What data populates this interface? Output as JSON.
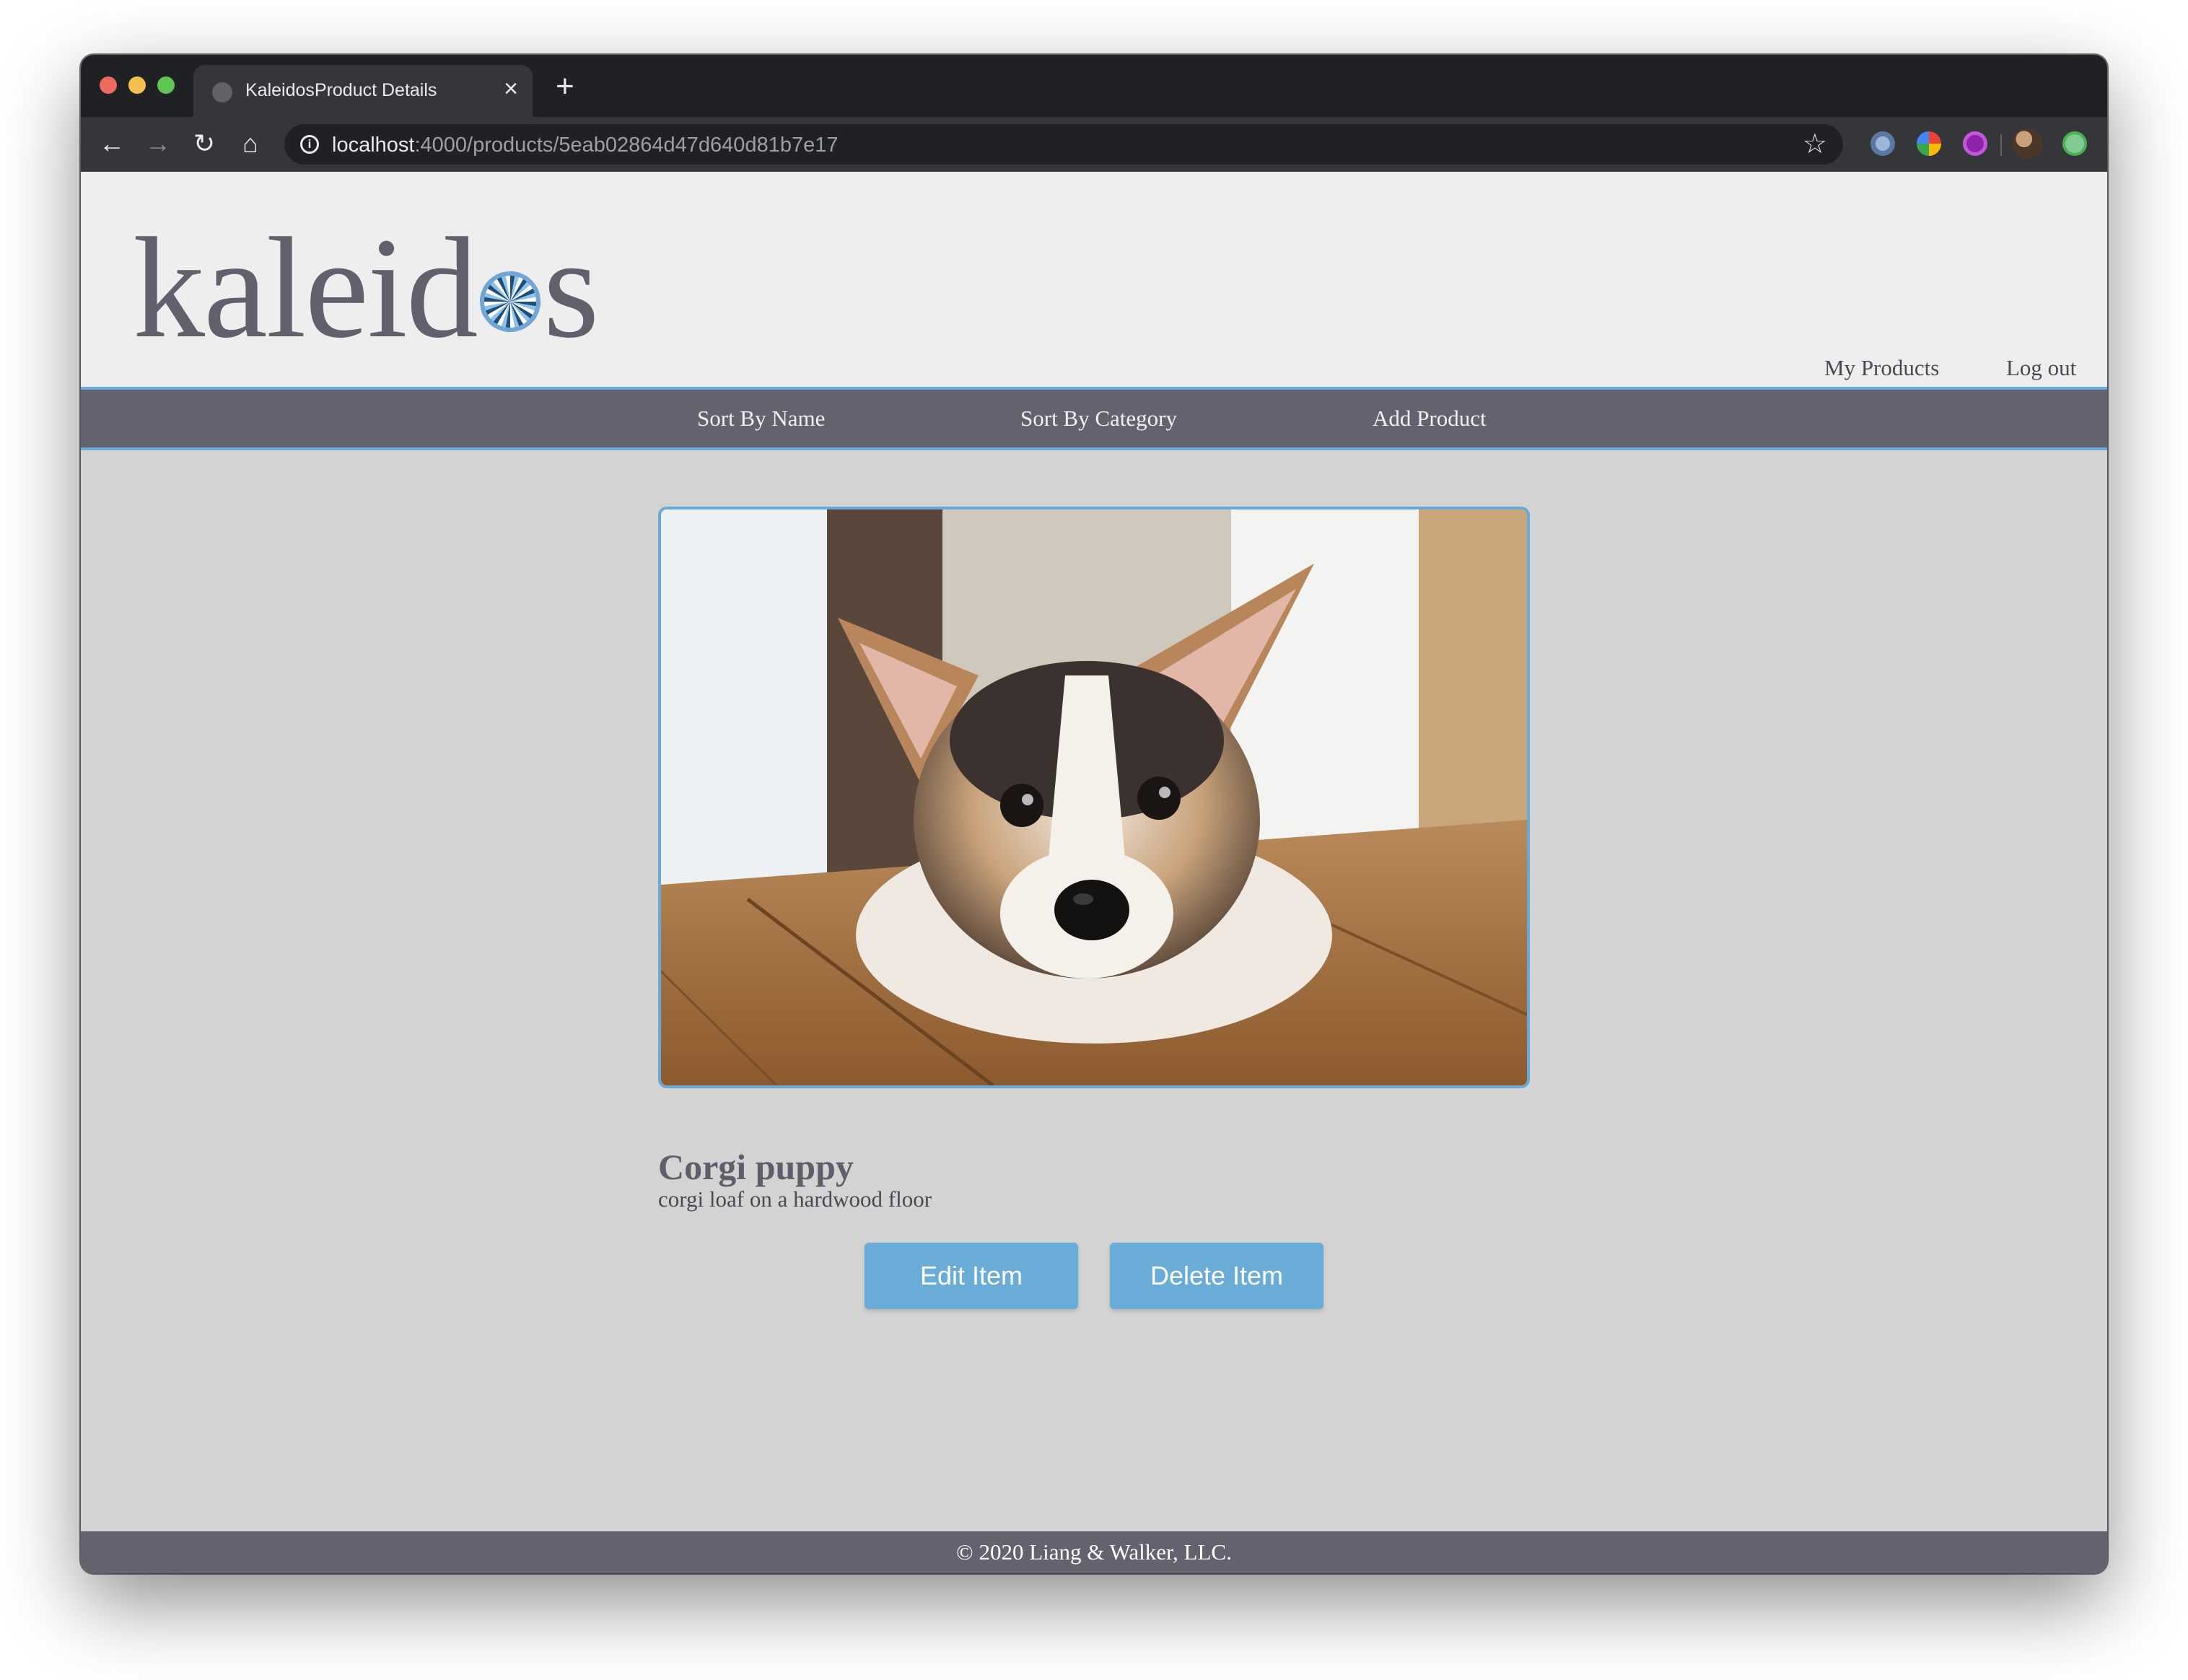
{
  "browser": {
    "tab_title": "KaleidosProduct Details",
    "tab_close": "×",
    "new_tab": "+",
    "url_host": "localhost",
    "url_rest": ":4000/products/5eab02864d47d640d81b7e17"
  },
  "header": {
    "logo_before": "kaleid",
    "logo_after": "s",
    "links": [
      "My Products",
      "Log out"
    ]
  },
  "nav": {
    "items": [
      "Sort By Name",
      "Sort By Category",
      "Add Product"
    ]
  },
  "product": {
    "name": "Corgi puppy",
    "description": "corgi loaf on a hardwood floor",
    "edit_label": "Edit Item",
    "delete_label": "Delete Item"
  },
  "footer": {
    "text": "© 2020 Liang & Walker, LLC."
  },
  "colors": {
    "accent": "#6aacd8",
    "nav_bg": "#63626e",
    "page_bg": "#d3d3d3",
    "header_bg": "#eeeeee"
  }
}
